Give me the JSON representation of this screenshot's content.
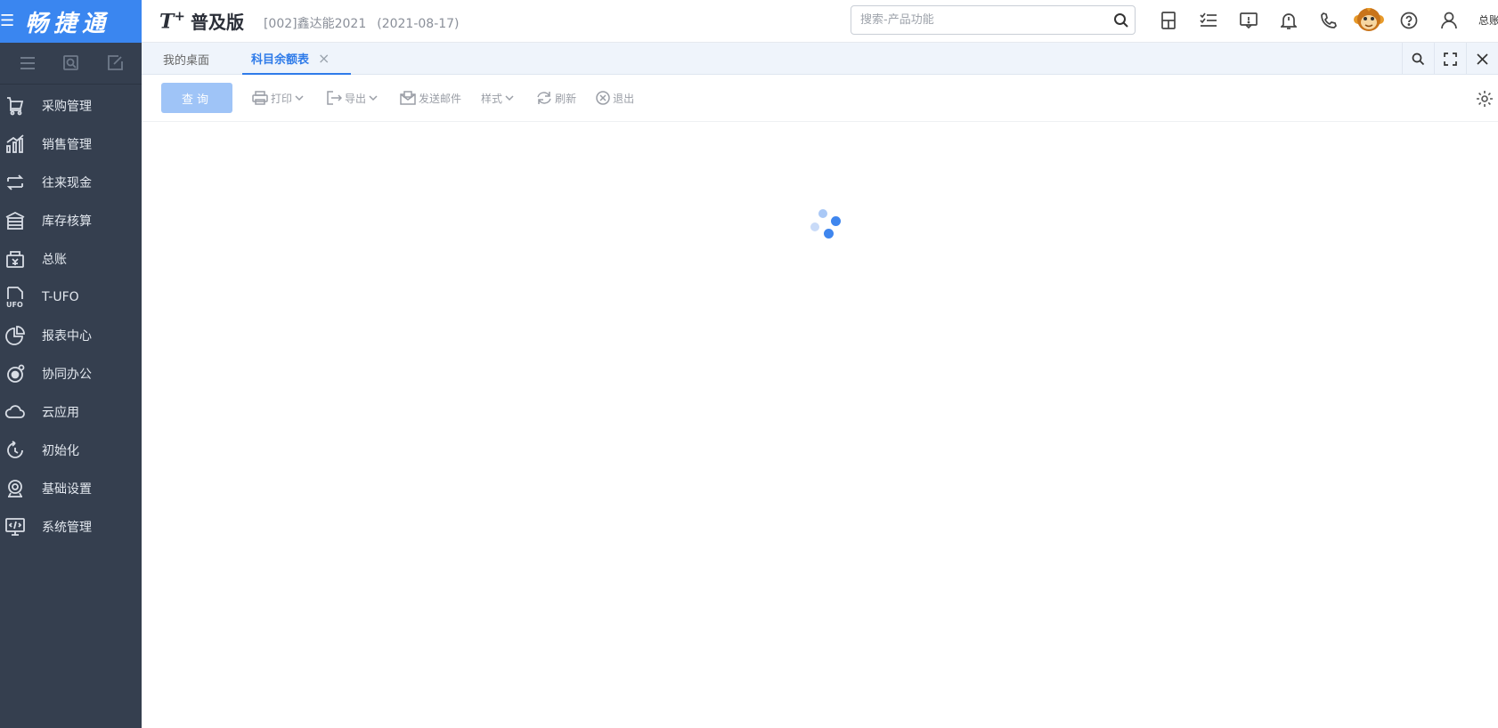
{
  "brand": {
    "menu_glyph": "三",
    "name": "畅捷通",
    "color": "#3a86f0"
  },
  "sidebar": {
    "background": "#353f4f",
    "tools": [
      {
        "icon": "menu-icon"
      },
      {
        "icon": "search-doc-icon"
      },
      {
        "icon": "edit-doc-icon"
      }
    ],
    "items": [
      {
        "label": "采购管理",
        "icon": "purchase-icon"
      },
      {
        "label": "销售管理",
        "icon": "sales-chart-icon"
      },
      {
        "label": "往来现金",
        "icon": "exchange-icon"
      },
      {
        "label": "库存核算",
        "icon": "inventory-icon"
      },
      {
        "label": "总账",
        "icon": "ledger-icon"
      },
      {
        "label": "T-UFO",
        "icon": "ufo-file-icon"
      },
      {
        "label": "报表中心",
        "icon": "pie-chart-icon"
      },
      {
        "label": "协同办公",
        "icon": "collab-icon"
      },
      {
        "label": "云应用",
        "icon": "cloud-icon"
      },
      {
        "label": "初始化",
        "icon": "refresh-icon"
      },
      {
        "label": "基础设置",
        "icon": "settings-base-icon"
      },
      {
        "label": "系统管理",
        "icon": "monitor-code-icon"
      }
    ]
  },
  "header": {
    "product_logo": "T",
    "product_logo_sup": "+",
    "edition": "普及版",
    "account": "[002]鑫达能2021",
    "date": "(2021-08-17)",
    "search_placeholder": "搜索-产品功能",
    "icons": [
      "calculator-icon",
      "task-list-icon",
      "message-icon",
      "bell-icon",
      "phone-icon",
      "monkey-avatar-icon",
      "help-icon",
      "user-icon"
    ],
    "user_label": "总账"
  },
  "tabs": {
    "desk_label": "我的桌面",
    "active_label": "科目余额表",
    "close_glyph": "×",
    "accent": "#2f7be9"
  },
  "toolbar": {
    "query_label": "查询",
    "print_label": "打印",
    "export_label": "导出",
    "email_label": "发送邮件",
    "style_label": "样式",
    "refresh_label": "刷新",
    "exit_label": "退出"
  },
  "content": {
    "state": "loading"
  }
}
